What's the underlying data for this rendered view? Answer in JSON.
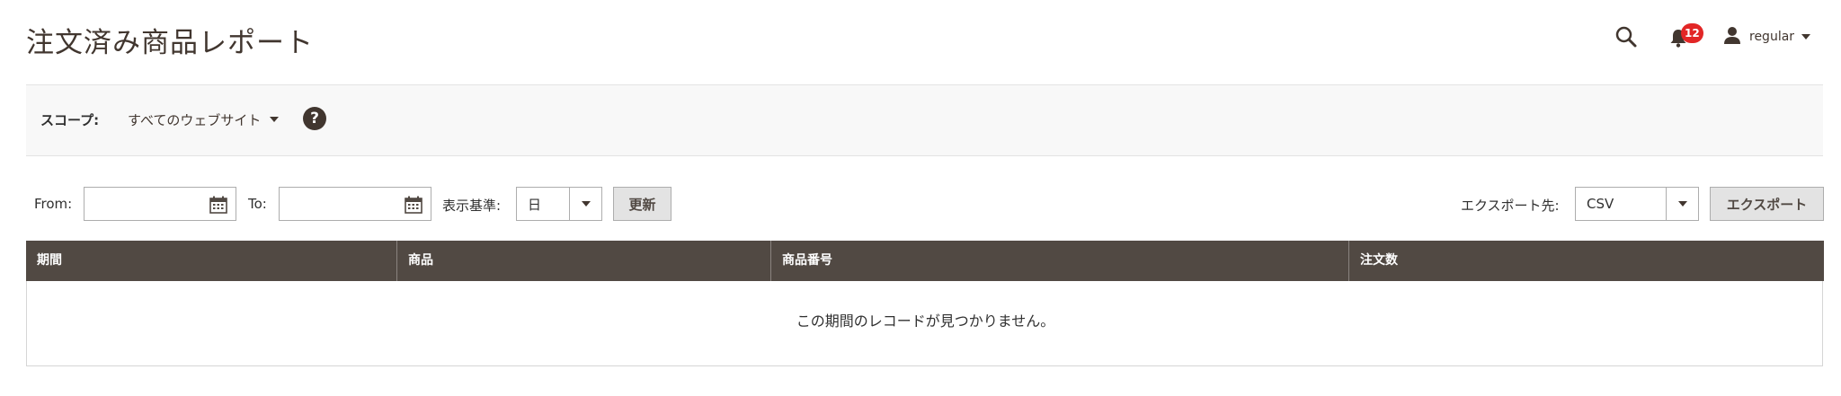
{
  "page": {
    "title": "注文済み商品レポート"
  },
  "header": {
    "notifications_count": "12",
    "user_name": "regular"
  },
  "scope": {
    "label": "スコープ:",
    "selected": "すべてのウェブサイト"
  },
  "filters": {
    "from_label": "From:",
    "from_value": "",
    "to_label": "To:",
    "to_value": "",
    "period_label": "表示基準:",
    "period_value": "日",
    "refresh_label": "更新",
    "export_label": "エクスポート先:",
    "export_format": "CSV",
    "export_button": "エクスポート"
  },
  "grid": {
    "columns": [
      "期間",
      "商品",
      "商品番号",
      "注文数"
    ],
    "empty_message": "この期間のレコードが見つかりません。"
  },
  "icons": {
    "search": "search-icon",
    "bell": "bell-icon",
    "user": "user-icon",
    "help": "help-icon",
    "calendar": "calendar-icon"
  }
}
